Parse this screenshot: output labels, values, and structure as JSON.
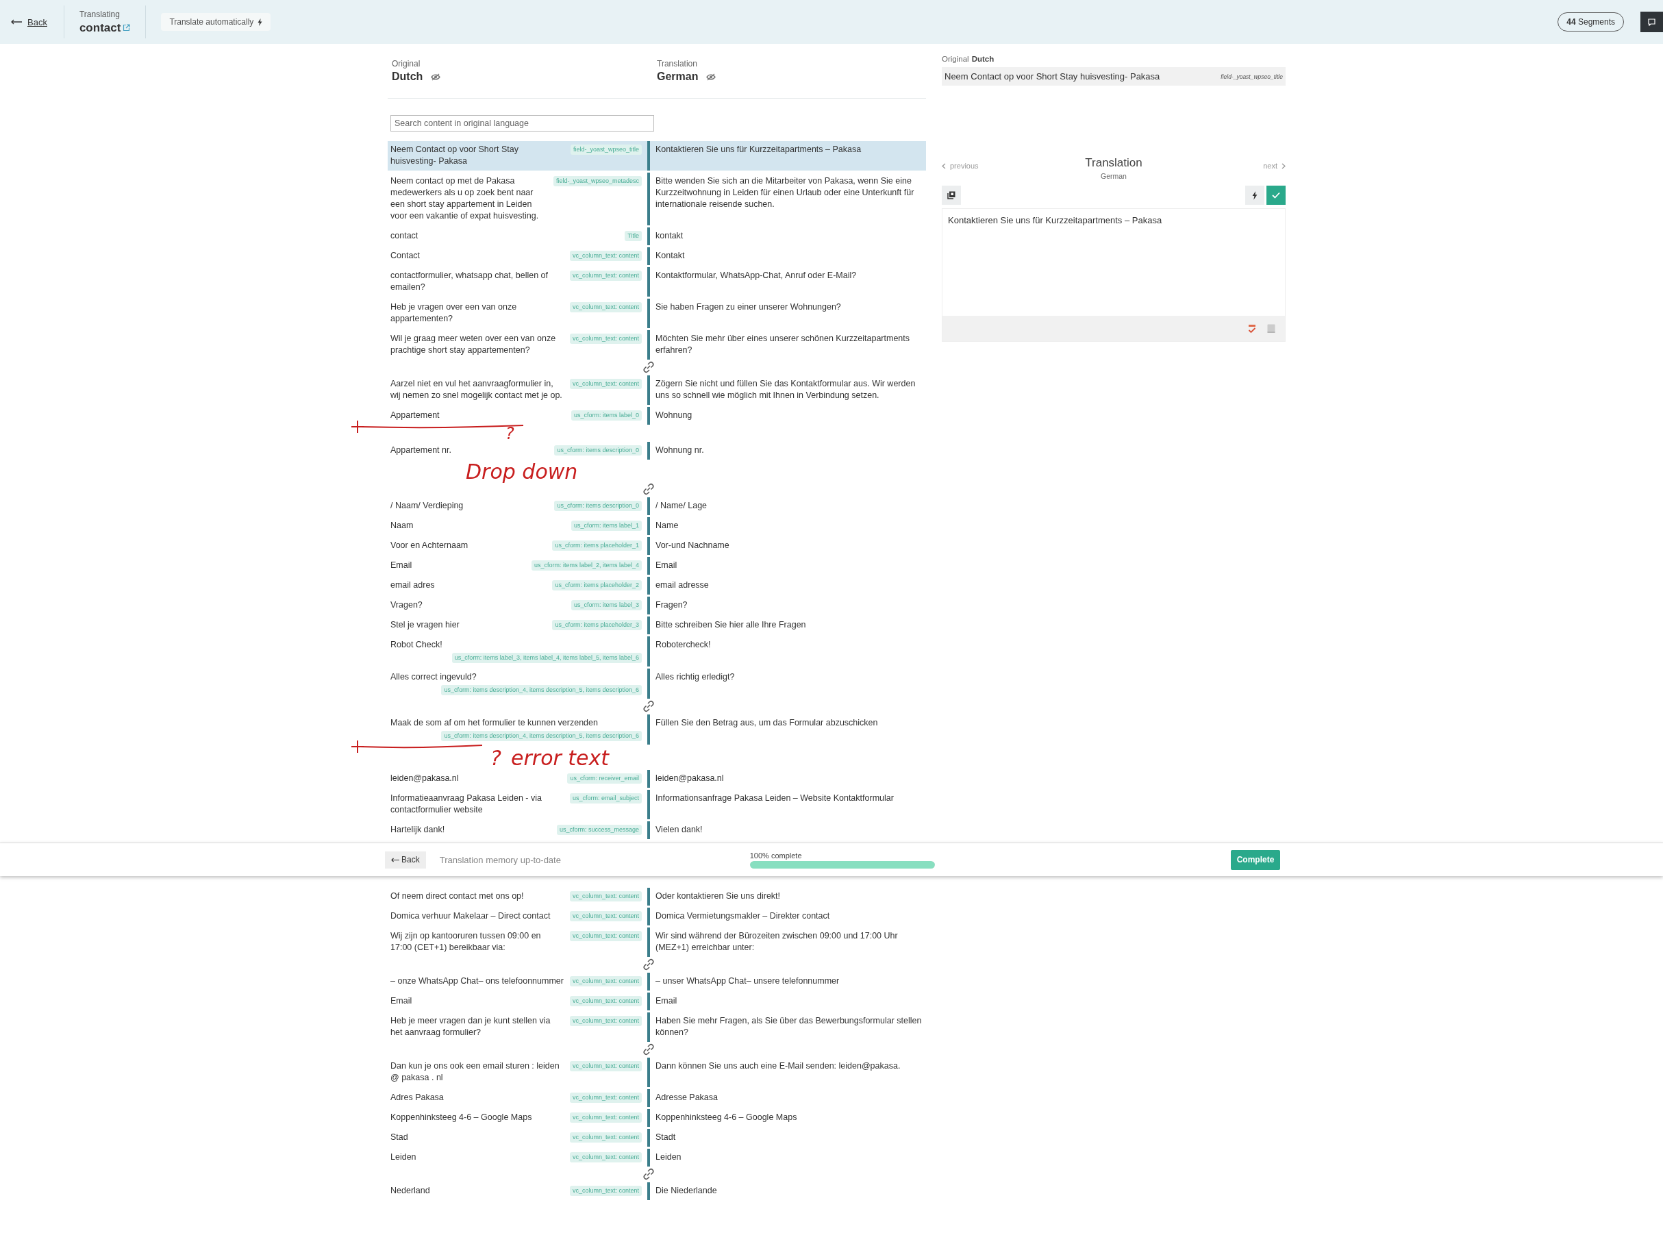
{
  "topbar": {
    "back": "Back",
    "subtitle": "Translating",
    "title": "contact",
    "auto_translate": "Translate automatically",
    "segments_count": "44",
    "segments_label": "Segments"
  },
  "languages": {
    "original_label": "Original",
    "original": "Dutch",
    "translation_label": "Translation",
    "translation": "German"
  },
  "search": {
    "placeholder": "Search content in original language"
  },
  "segment_groups_top": [
    [
      {
        "original": "Neem Contact op voor Short Stay huisvesting- Pakasa",
        "tag": "field-_yoast_wpseo_title",
        "translation": "Kontaktieren Sie uns für Kurzzeitapartments – Pakasa",
        "selected": true
      },
      {
        "original": "Neem contact op met de Pakasa medewerkers als u op zoek bent naar een short stay appartement in Leiden voor een vakantie of expat huisvesting.",
        "tag": "field-_yoast_wpseo_metadesc",
        "translation": "Bitte wenden Sie sich an die Mitarbeiter von Pakasa, wenn Sie eine Kurzzeitwohnung in Leiden für einen Urlaub oder eine Unterkunft für internationale reisende suchen.",
        "selected": false
      },
      {
        "original": "contact",
        "tag": "Title",
        "translation": "kontakt",
        "selected": false
      },
      {
        "original": "Contact",
        "tag": "vc_column_text: content",
        "translation": "Kontakt",
        "selected": false
      },
      {
        "original": "contactformulier, whatsapp chat, bellen of emailen?",
        "tag": "vc_column_text: content",
        "translation": "Kontaktformular, WhatsApp-Chat, Anruf oder E-Mail?",
        "selected": false
      },
      {
        "original": "Heb je vragen over een van onze appartementen?",
        "tag": "vc_column_text: content",
        "translation": "Sie haben Fragen zu einer unserer Wohnungen?",
        "selected": false
      },
      {
        "original": "Wil je graag meer weten over een van onze prachtige short stay appartementen?",
        "tag": "vc_column_text: content",
        "translation": "Möchten Sie mehr über eines unserer schönen Kurzzeitapartments erfahren?",
        "selected": false
      }
    ],
    [
      {
        "original": "Aarzel niet en vul het aanvraagformulier in, wij nemen zo snel mogelijk contact met je op.",
        "tag": "vc_column_text: content",
        "translation": "Zögern Sie nicht und füllen Sie das Kontaktformular aus. Wir werden uns so schnell wie möglich mit Ihnen in Verbindung setzen.",
        "selected": false
      },
      {
        "original": "Appartement",
        "tag": "us_cform: items label_0",
        "translation": "Wohnung",
        "selected": false
      },
      {
        "original": "Appartement nr.",
        "tag": "us_cform: items description_0",
        "translation": "Wohnung nr.",
        "selected": false
      }
    ],
    [
      {
        "original": "/ Naam/ Verdieping",
        "tag": "us_cform: items description_0",
        "translation": "/ Name/ Lage",
        "selected": false
      },
      {
        "original": "Naam",
        "tag": "us_cform: items label_1",
        "translation": "Name",
        "selected": false
      },
      {
        "original": "Voor en Achternaam",
        "tag": "us_cform: items placeholder_1",
        "translation": "Vor-und Nachname",
        "selected": false
      },
      {
        "original": "Email",
        "tag": "us_cform: items label_2, items label_4",
        "translation": "Email",
        "selected": false
      },
      {
        "original": "email adres",
        "tag": "us_cform: items placeholder_2",
        "translation": "email adresse",
        "selected": false
      },
      {
        "original": "Vragen?",
        "tag": "us_cform: items label_3",
        "translation": "Fragen?",
        "selected": false
      },
      {
        "original": "Stel je vragen hier",
        "tag": "us_cform: items placeholder_3",
        "translation": "Bitte schreiben Sie hier alle Ihre Fragen",
        "selected": false
      },
      {
        "original": "Robot Check!",
        "tag": "us_cform: items label_3, items label_4, items label_5, items label_6",
        "translation": "Robotercheck!",
        "selected": false
      },
      {
        "original": "Alles correct ingevuld?",
        "tag": "us_cform: items description_4, items description_5, items description_6",
        "translation": "Alles richtig erledigt?",
        "selected": false
      }
    ],
    [
      {
        "original": "Maak de som af om het formulier te kunnen verzenden",
        "tag": "us_cform: items description_4, items description_5, items description_6",
        "translation": "Füllen Sie den Betrag aus, um das Formular abzuschicken",
        "selected": false
      },
      {
        "original": "leiden@pakasa.nl",
        "tag": "us_cform: receiver_email",
        "translation": "leiden@pakasa.nl",
        "selected": false
      },
      {
        "original": "Informatieaanvraag Pakasa Leiden - via contactformulier website",
        "tag": "us_cform: email_subject",
        "translation": "Informationsanfrage Pakasa Leiden – Website Kontaktformular",
        "selected": false
      },
      {
        "original": "Hartelijk dank!",
        "tag": "us_cform: success_message",
        "translation": "Vielen dank!",
        "selected": false
      }
    ]
  ],
  "status_bar": {
    "back": "Back",
    "memory": "Translation memory up-to-date",
    "progress_label": "100% complete",
    "level": 1,
    "complete": "Complete"
  },
  "segment_groups_bottom": [
    [
      {
        "original": "Of neem direct contact met ons op!",
        "tag": "vc_column_text: content",
        "translation": "Oder kontaktieren Sie uns direkt!",
        "selected": false
      },
      {
        "original": "Domica verhuur Makelaar – Direct contact",
        "tag": "vc_column_text: content",
        "translation": "Domica Vermietungsmakler – Direkter contact",
        "selected": false
      },
      {
        "original": "Wij zijn op kantooruren tussen 09:00 en 17:00 (CET+1) bereikbaar via:",
        "tag": "vc_column_text: content",
        "translation": "Wir sind während der Bürozeiten zwischen 09:00 und 17:00 Uhr (MEZ+1) erreichbar unter:",
        "selected": false
      }
    ],
    [
      {
        "original": "– onze WhatsApp Chat– ons telefoonnummer",
        "tag": "vc_column_text: content",
        "translation": "– unser WhatsApp Chat– unsere telefonnummer",
        "selected": false
      },
      {
        "original": "Email",
        "tag": "vc_column_text: content",
        "translation": "Email",
        "selected": false
      },
      {
        "original": "Heb je meer vragen dan je kunt stellen via het aanvraag formulier?",
        "tag": "vc_column_text: content",
        "translation": "Haben Sie mehr Fragen, als Sie über das Bewerbungsformular stellen können?",
        "selected": false
      }
    ],
    [
      {
        "original": "Dan kun je ons ook een email sturen : leiden @ pakasa . nl",
        "tag": "vc_column_text: content",
        "translation": "Dann können Sie uns auch eine E-Mail senden: leiden@pakasa.",
        "selected": false
      },
      {
        "original": "Adres Pakasa",
        "tag": "vc_column_text: content",
        "translation": "Adresse Pakasa",
        "selected": false
      },
      {
        "original": "Koppenhinksteeg 4-6 – Google Maps",
        "tag": "vc_column_text: content",
        "translation": "Koppenhinksteeg 4-6 – Google Maps",
        "selected": false
      },
      {
        "original": "Stad",
        "tag": "vc_column_text: content",
        "translation": "Stadt",
        "selected": false
      },
      {
        "original": "Leiden",
        "tag": "vc_column_text: content",
        "translation": "Leiden",
        "selected": false
      }
    ],
    [
      {
        "original": "Nederland",
        "tag": "vc_column_text: content",
        "translation": "Die Niederlande",
        "selected": false
      }
    ]
  ],
  "editor": {
    "original_label": "Original",
    "original_lang": "Dutch",
    "source_text": "Neem Contact op voor Short Stay huisvesting- Pakasa",
    "source_tag": "field-_yoast_wpseo_title",
    "previous": "previous",
    "title": "Translation",
    "lang": "German",
    "next": "next",
    "value": "Kontaktieren Sie uns für Kurzzeitapartments – Pakasa"
  },
  "annotations": [
    {
      "text": "?"
    },
    {
      "text": "Drop down"
    },
    {
      "text": "?"
    },
    {
      "text": "error text"
    }
  ]
}
